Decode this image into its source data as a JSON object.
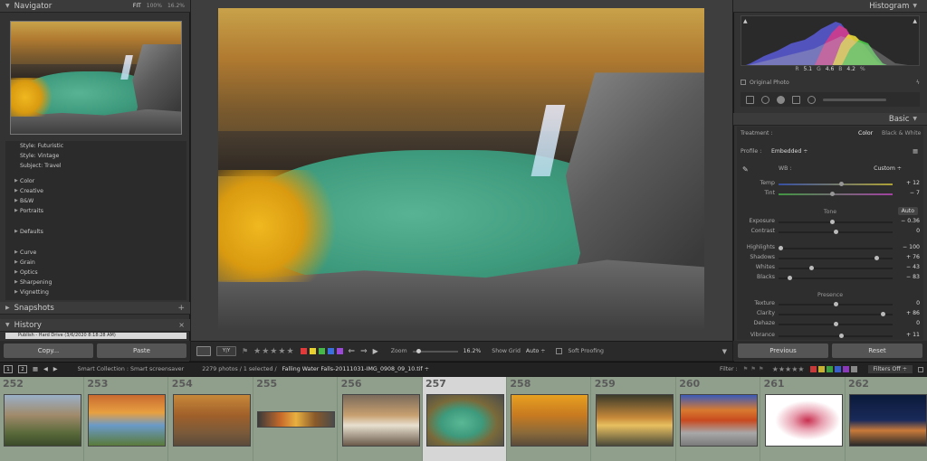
{
  "navigator": {
    "title": "Navigator",
    "options": [
      "FIT",
      "100%",
      "16.2%"
    ],
    "selected_option": "FIT"
  },
  "left_list": {
    "group1": [
      "Style: Futuristic",
      "Style: Vintage",
      "Subject: Travel"
    ],
    "group2": [
      "Color",
      "Creative",
      "B&W",
      "Portraits"
    ],
    "group3": [
      "Defaults"
    ],
    "group4": [
      "Curve",
      "Grain",
      "Optics",
      "Sharpening",
      "Vignetting"
    ]
  },
  "snapshots": {
    "title": "Snapshots",
    "add_label": "+"
  },
  "history": {
    "title": "History",
    "close_label": "×",
    "item": "Publish - Hard Drive (3/6/2020 8:18:28 AM)"
  },
  "left_buttons": {
    "copy": "Copy...",
    "paste": "Paste"
  },
  "toolbar": {
    "stars": "★★★★★",
    "label_colors": [
      "#e23a3a",
      "#e8d030",
      "#46b84a",
      "#3a6fe0",
      "#9a4ad6"
    ],
    "zoom_label": "Zoom",
    "zoom_value": "16.2%",
    "grid_label": "Show Grid",
    "grid_value": "Auto ÷",
    "soft_proofing": "Soft Proofing"
  },
  "histogram": {
    "title": "Histogram",
    "readout": {
      "r_label": "R",
      "r": "5.1",
      "g_label": "G",
      "g": "4.6",
      "b_label": "B",
      "b": "4.2",
      "unit": "%"
    },
    "original_photo": "Original Photo"
  },
  "basic": {
    "title": "Basic",
    "treatment_label": "Treatment :",
    "treatment_color": "Color",
    "treatment_bw": "Black & White",
    "profile_label": "Profile :",
    "profile_value": "Embedded ÷",
    "wb_label": "WB :",
    "wb_value": "Custom ÷",
    "tone_label": "Tone",
    "auto_label": "Auto",
    "presence_label": "Presence",
    "sliders": [
      {
        "name": "Temp",
        "value": "+ 12",
        "pos": 0.55
      },
      {
        "name": "Tint",
        "value": "− 7",
        "pos": 0.47
      },
      {
        "name": "Exposure",
        "value": "− 0.36",
        "pos": 0.47
      },
      {
        "name": "Contrast",
        "value": "0",
        "pos": 0.5
      },
      {
        "name": "Highlights",
        "value": "− 100",
        "pos": 0.0
      },
      {
        "name": "Shadows",
        "value": "+ 76",
        "pos": 0.88
      },
      {
        "name": "Whites",
        "value": "− 43",
        "pos": 0.28
      },
      {
        "name": "Blacks",
        "value": "− 83",
        "pos": 0.08
      },
      {
        "name": "Texture",
        "value": "0",
        "pos": 0.5
      },
      {
        "name": "Clarity",
        "value": "+ 86",
        "pos": 0.93
      },
      {
        "name": "Dehaze",
        "value": "0",
        "pos": 0.5
      },
      {
        "name": "Vibrance",
        "value": "+ 11",
        "pos": 0.55
      }
    ]
  },
  "right_buttons": {
    "previous": "Previous",
    "reset": "Reset"
  },
  "filmstrip_bar": {
    "monitor1": "1",
    "monitor2": "2",
    "source": "Smart Collection : Smart screensaver",
    "count": "2279 photos / 1 selected /",
    "filename": "Falling Water Falls-20111031-IMG_0908_09_10.tif ÷",
    "filter_label": "Filter :",
    "filter_stars": "★★★★★",
    "filter_colors": [
      "#c83a3a",
      "#c8b030",
      "#3aa040",
      "#3a5fc8",
      "#8a3ab8",
      "#888888"
    ],
    "filters_off": "Filters Off ÷"
  },
  "filmstrip": {
    "numbers": [
      "252",
      "253",
      "254",
      "255",
      "256",
      "257",
      "258",
      "259",
      "260",
      "261",
      "262"
    ],
    "selected": "257"
  }
}
